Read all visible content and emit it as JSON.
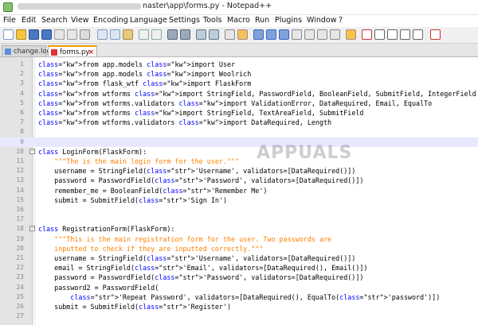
{
  "window": {
    "title_suffix": "naster\\app\\forms.py - Notepad++"
  },
  "menu": [
    "File",
    "Edit",
    "Search",
    "View",
    "Encoding",
    "Language",
    "Settings",
    "Tools",
    "Macro",
    "Run",
    "Plugins",
    "Window",
    "?"
  ],
  "tabs": [
    {
      "label": "change.log",
      "active": false
    },
    {
      "label": "forms.py",
      "active": true
    }
  ],
  "watermark": "APPUALS",
  "editor": {
    "lines": [
      {
        "n": "1",
        "text": "from app.models import User"
      },
      {
        "n": "2",
        "text": "from app.models import Woolrich"
      },
      {
        "n": "3",
        "text": "from flask_wtf import FlaskForm"
      },
      {
        "n": "4",
        "text": "from wtforms import StringField, PasswordField, BooleanField, SubmitField, IntegerField"
      },
      {
        "n": "5",
        "text": "from wtforms.validators import ValidationError, DataRequired, Email, EqualTo"
      },
      {
        "n": "6",
        "text": "from wtforms import StringField, TextAreaField, SubmitField"
      },
      {
        "n": "7",
        "text": "from wtforms.validators import DataRequired, Length"
      },
      {
        "n": "8",
        "text": ""
      },
      {
        "n": "9",
        "text": ""
      },
      {
        "n": "10",
        "text": "class LoginForm(FlaskForm):"
      },
      {
        "n": "11",
        "text": "    \"\"\"The is the main login form for the user.\"\"\""
      },
      {
        "n": "12",
        "text": "    username = StringField('Username', validators=[DataRequired()])"
      },
      {
        "n": "13",
        "text": "    password = PasswordField('Password', validators=[DataRequired()])"
      },
      {
        "n": "14",
        "text": "    remember_me = BooleanField('Remember Me')"
      },
      {
        "n": "15",
        "text": "    submit = SubmitField('Sign In')"
      },
      {
        "n": "16",
        "text": ""
      },
      {
        "n": "17",
        "text": ""
      },
      {
        "n": "18",
        "text": "class RegistrationForm(FlaskForm):"
      },
      {
        "n": "19",
        "text": "    \"\"\"This is the main registration form for the user. Two passwords are"
      },
      {
        "n": "20",
        "text": "    inputted to check if they are inputted correctly.\"\"\""
      },
      {
        "n": "21",
        "text": "    username = StringField('Username', validators=[DataRequired()])"
      },
      {
        "n": "22",
        "text": "    email = StringField('Email', validators=[DataRequired(), Email()])"
      },
      {
        "n": "23",
        "text": "    password = PasswordField('Password', validators=[DataRequired()])"
      },
      {
        "n": "24",
        "text": "    password2 = PasswordField("
      },
      {
        "n": "25",
        "text": "        'Repeat Password', validators=[DataRequired(), EqualTo('password')])"
      },
      {
        "n": "26",
        "text": "    submit = SubmitField('Register')"
      },
      {
        "n": "27",
        "text": ""
      }
    ]
  }
}
